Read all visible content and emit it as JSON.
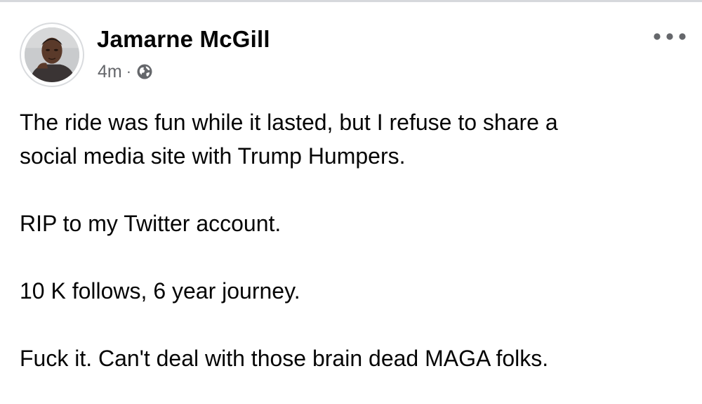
{
  "post": {
    "author": "Jamarne McGill",
    "timestamp": "4m",
    "separator": "·",
    "privacy_icon": "globe-icon",
    "more_icon": "more-horizontal-icon",
    "paragraphs": [
      [
        "The ride was fun while it lasted, but I refuse to share a",
        "social media site with Trump Humpers."
      ],
      [
        "RIP to my Twitter account."
      ],
      [
        "10 K follows, 6 year journey."
      ],
      [
        "Fuck it. Can't deal with those brain dead MAGA folks."
      ]
    ]
  },
  "colors": {
    "text": "#050505",
    "secondary_text": "#65676b",
    "icon": "#65676b",
    "divider": "#d6d8dc"
  }
}
